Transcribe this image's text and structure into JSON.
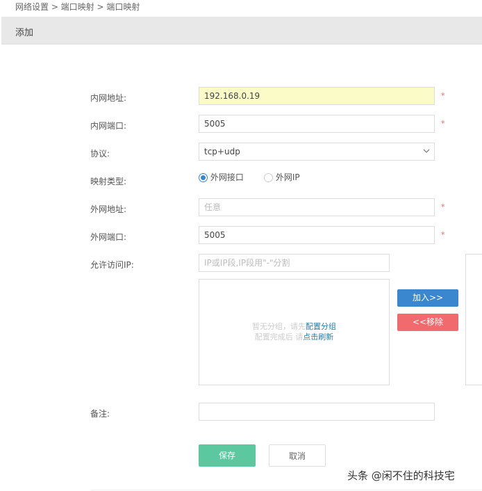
{
  "breadcrumb": "网络设置 > 端口映射 > 端口映射",
  "header": {
    "title": "添加"
  },
  "form": {
    "lan_ip": {
      "label": "内网地址:",
      "value": "192.168.0.19",
      "required": "*"
    },
    "lan_port": {
      "label": "内网端口:",
      "value": "5005",
      "required": "*"
    },
    "protocol": {
      "label": "协议:",
      "value": "tcp+udp"
    },
    "map_type": {
      "label": "映射类型:",
      "options": [
        "外网接口",
        "外网IP"
      ],
      "selected": "外网接口"
    },
    "wan_addr": {
      "label": "外网地址:",
      "placeholder": "任意",
      "required": "*"
    },
    "wan_port": {
      "label": "外网端口:",
      "value": "5005",
      "required": "*"
    },
    "allow_ip": {
      "label": "允许访问IP:",
      "placeholder": "IP或IP段,IP段用\"-\"分割",
      "empty_line1": "暂无分组，请先",
      "empty_link1": "配置分组",
      "empty_line2": "配置完成后 请",
      "empty_link2": "点击刷新",
      "add_label": "加入>>",
      "remove_label": "<<移除"
    },
    "remark": {
      "label": "备注:",
      "value": ""
    }
  },
  "actions": {
    "save": "保存",
    "cancel": "取消"
  },
  "watermark": "头条 @闲不住的科技宅",
  "colors": {
    "add": "#3a87d0",
    "remove": "#f06a6e",
    "save": "#5cc8a0"
  }
}
